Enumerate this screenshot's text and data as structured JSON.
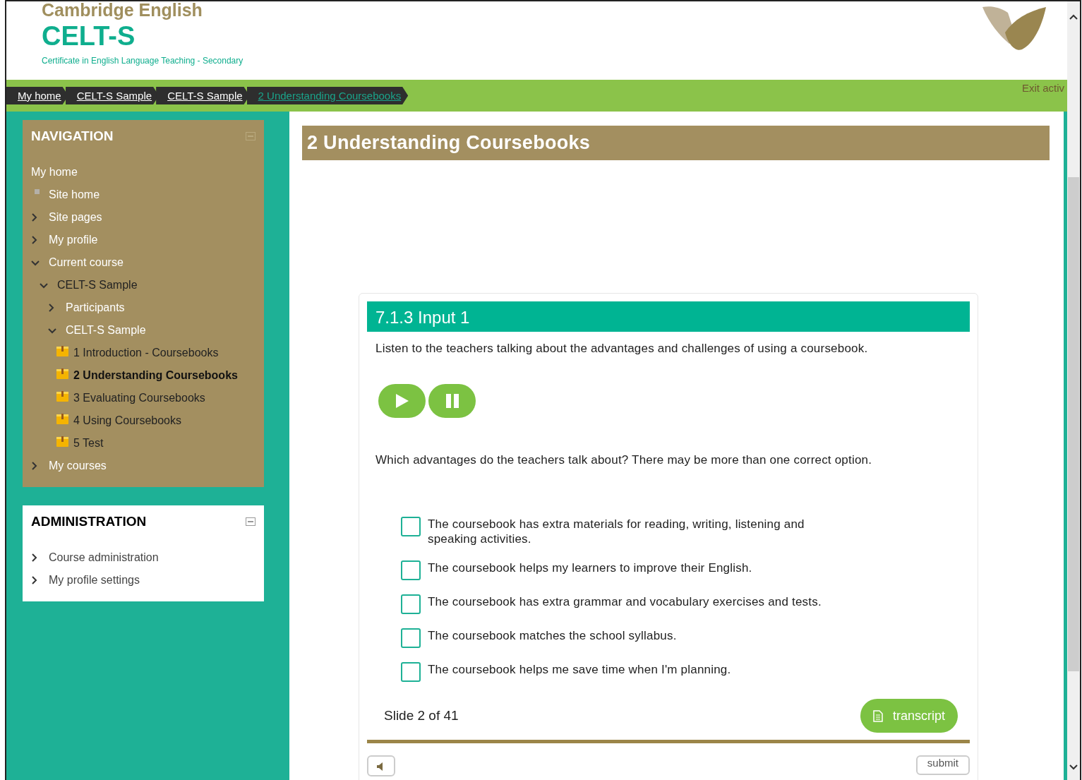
{
  "header": {
    "brand": "Cambridge English",
    "product": "CELT-S",
    "subtitle": "Certificate in English Language Teaching - Secondary"
  },
  "breadcrumbs": [
    {
      "label": "My home",
      "selected": false
    },
    {
      "label": "CELT-S Sample",
      "selected": false
    },
    {
      "label": "CELT-S Sample",
      "selected": false
    },
    {
      "label": "2 Understanding Coursebooks",
      "selected": true
    }
  ],
  "exit_link": "Exit activ",
  "navigation": {
    "title": "NAVIGATION",
    "items": [
      {
        "kind": "plain",
        "label": "My home"
      },
      {
        "kind": "leaf",
        "label": "Site home"
      },
      {
        "kind": "branch",
        "label": "Site pages",
        "expanded": false
      },
      {
        "kind": "branch",
        "label": "My profile",
        "expanded": false
      },
      {
        "kind": "branch",
        "label": "Current course",
        "expanded": true,
        "children": [
          {
            "kind": "branch",
            "label": "CELT-S Sample",
            "expanded": true,
            "children": [
              {
                "kind": "branch",
                "label": "Participants",
                "expanded": false
              },
              {
                "kind": "branch",
                "label": "CELT-S Sample",
                "expanded": true,
                "children": [
                  {
                    "kind": "activity",
                    "label": "1 Introduction - Coursebooks",
                    "selected": false
                  },
                  {
                    "kind": "activity",
                    "label": "2 Understanding Coursebooks",
                    "selected": true
                  },
                  {
                    "kind": "activity",
                    "label": "3 Evaluating Coursebooks",
                    "selected": false
                  },
                  {
                    "kind": "activity",
                    "label": "4 Using Coursebooks",
                    "selected": false
                  },
                  {
                    "kind": "activity",
                    "label": "5 Test",
                    "selected": false
                  }
                ]
              }
            ]
          }
        ]
      },
      {
        "kind": "branch",
        "label": "My courses",
        "expanded": false
      }
    ]
  },
  "administration": {
    "title": "ADMINISTRATION",
    "items": [
      {
        "kind": "branch",
        "label": "Course administration",
        "expanded": false
      },
      {
        "kind": "branch",
        "label": "My profile settings",
        "expanded": false
      }
    ]
  },
  "page_title": "2 Understanding Coursebooks",
  "activity": {
    "heading": "7.1.3 Input 1",
    "instruction": "Listen to the teachers talking about the advantages and challenges of using a coursebook.",
    "question": "Which advantages do the teachers talk about? There may be more than one correct option.",
    "options": [
      {
        "label": "The coursebook has extra materials for reading, writing, listening and speaking activities.",
        "checked": false
      },
      {
        "label": "The coursebook helps my learners to improve their English.",
        "checked": false
      },
      {
        "label": "The coursebook has extra grammar and vocabulary exercises and tests.",
        "checked": false
      },
      {
        "label": "The coursebook matches the school syllabus.",
        "checked": false
      },
      {
        "label": "The coursebook helps me save time when I'm planning.",
        "checked": false
      }
    ],
    "slide_counter": "Slide 2 of 41",
    "transcript_button": "transcript",
    "submit_button": "submit"
  }
}
